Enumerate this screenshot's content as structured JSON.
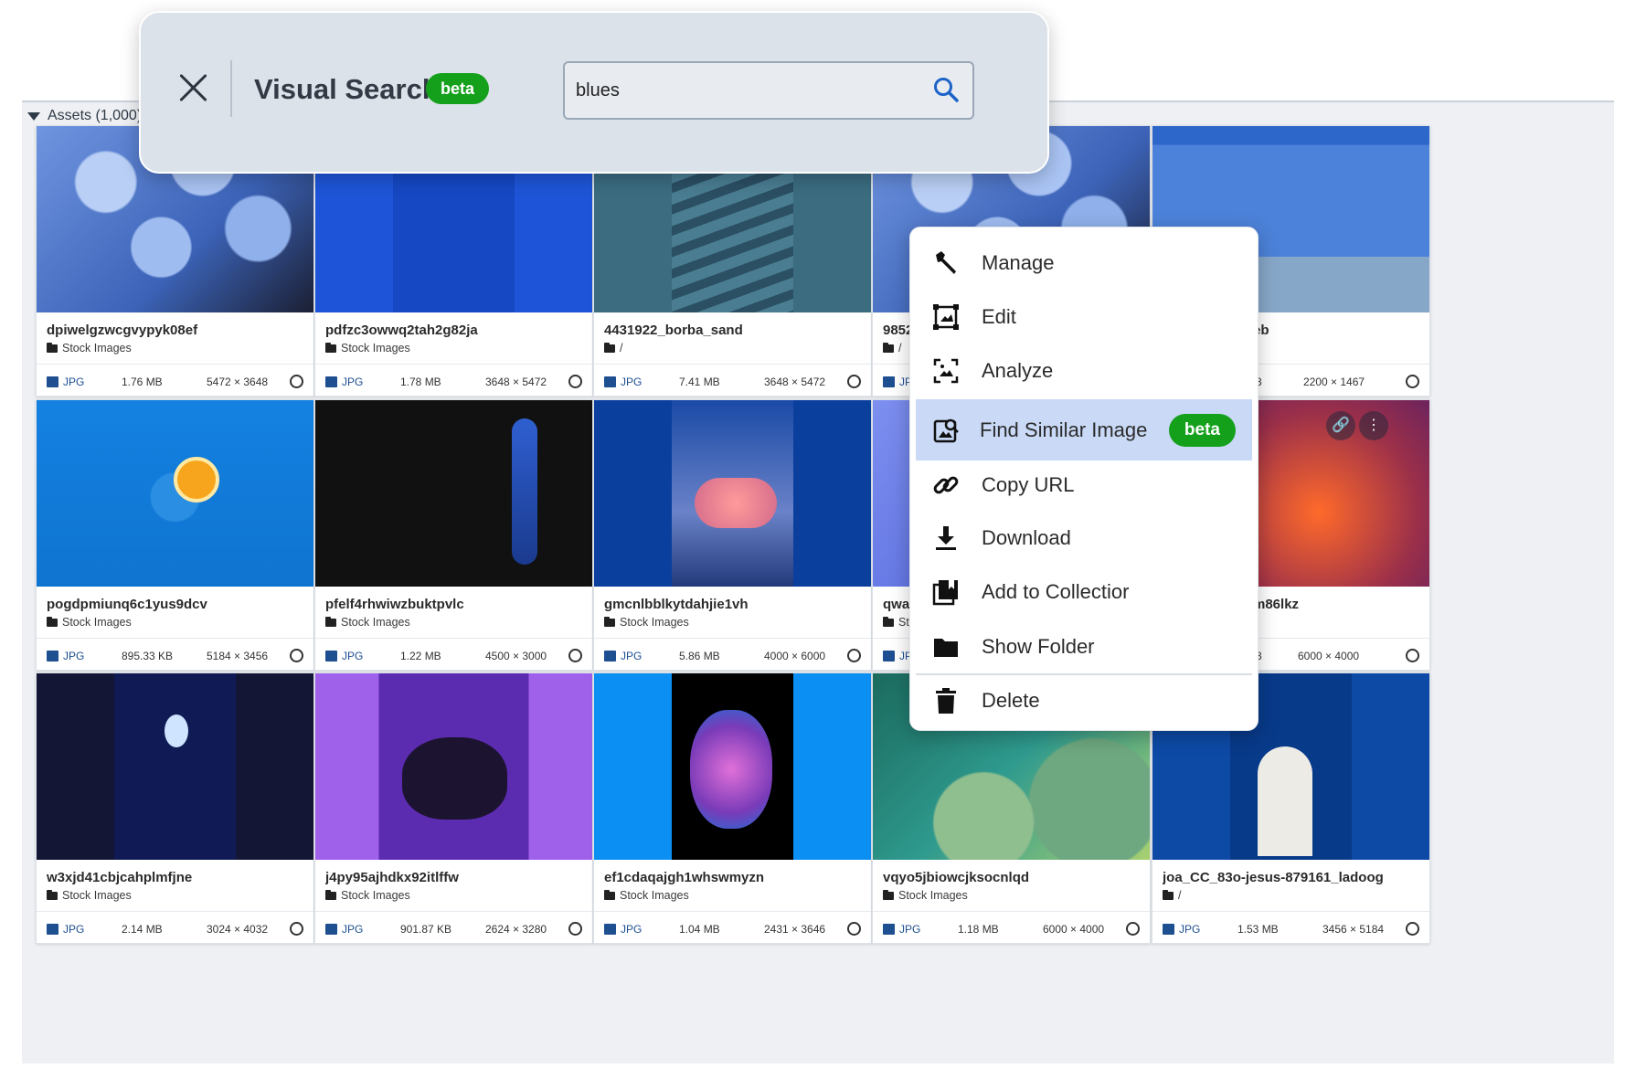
{
  "assets_label": "Assets (1,000)",
  "visual_search": {
    "title": "Visual Search",
    "badge": "beta",
    "query": "blues"
  },
  "context_menu": {
    "items": [
      {
        "label": "Manage",
        "icon": "wrench-icon"
      },
      {
        "label": "Edit",
        "icon": "edit-frame-icon"
      },
      {
        "label": "Analyze",
        "icon": "analyze-image-icon"
      },
      {
        "label": "Find Similar Image",
        "icon": "find-similar-image-icon",
        "badge": "beta",
        "active": true
      },
      {
        "label": "Copy URL",
        "icon": "link-icon"
      },
      {
        "label": "Download",
        "icon": "download-icon"
      },
      {
        "label": "Add to Collectior",
        "icon": "collection-icon"
      },
      {
        "label": "Show Folder",
        "icon": "folder-icon"
      },
      {
        "label": "Delete",
        "icon": "trash-icon"
      }
    ]
  },
  "cards": [
    {
      "name": "dpiwelgzwcgvypyk08ef",
      "folder": "Stock Images",
      "type": "JPG",
      "size": "1.76 MB",
      "dims": "5472 × 3648"
    },
    {
      "name": "pdfzc3owwq2tah2g82ja",
      "folder": "Stock Images",
      "type": "JPG",
      "size": "1.78 MB",
      "dims": "3648 × 5472"
    },
    {
      "name": "4431922_borba_sand",
      "folder": "/",
      "type": "JPG",
      "size": "7.41 MB",
      "dims": "3648 × 5472"
    },
    {
      "name": "9852",
      "folder": "/",
      "type": "JPG",
      "size": "",
      "dims": ""
    },
    {
      "name": "eb",
      "folder": "",
      "type": "",
      "size": "3",
      "dims": "2200 × 1467"
    },
    {
      "name": "pogdpmiunq6c1yus9dcv",
      "folder": "Stock Images",
      "type": "JPG",
      "size": "895.33 KB",
      "dims": "5184 × 3456"
    },
    {
      "name": "pfelf4rhwiwzbuktpvlc",
      "folder": "Stock Images",
      "type": "JPG",
      "size": "1.22 MB",
      "dims": "4500 × 3000"
    },
    {
      "name": "gmcnlbblkytdahjie1vh",
      "folder": "Stock Images",
      "type": "JPG",
      "size": "5.86 MB",
      "dims": "4000 × 6000"
    },
    {
      "name": "qwa7",
      "folder": "Stc",
      "type": "JPC",
      "size": "",
      "dims": ""
    },
    {
      "name": "m86lkz",
      "folder": "",
      "type": "",
      "size": "3",
      "dims": "6000 × 4000"
    },
    {
      "name": "w3xjd41cbjcahplmfjne",
      "folder": "Stock Images",
      "type": "JPG",
      "size": "2.14 MB",
      "dims": "3024 × 4032"
    },
    {
      "name": "j4py95ajhdkx92itlffw",
      "folder": "Stock Images",
      "type": "JPG",
      "size": "901.87 KB",
      "dims": "2624 × 3280"
    },
    {
      "name": "ef1cdaqajgh1whswmyzn",
      "folder": "Stock Images",
      "type": "JPG",
      "size": "1.04 MB",
      "dims": "2431 × 3646"
    },
    {
      "name": "vqyo5jbiowcjksocnlqd",
      "folder": "Stock Images",
      "type": "JPG",
      "size": "1.18 MB",
      "dims": "6000 × 4000"
    },
    {
      "name": "joa_CC_83o-jesus-879161_ladoog",
      "folder": "/",
      "type": "JPG",
      "size": "1.53 MB",
      "dims": "3456 × 5184"
    }
  ],
  "colors": {
    "beta_badge": "#15a01c",
    "active_item": "#c9d9f6",
    "accent_blue": "#1d63c8"
  }
}
